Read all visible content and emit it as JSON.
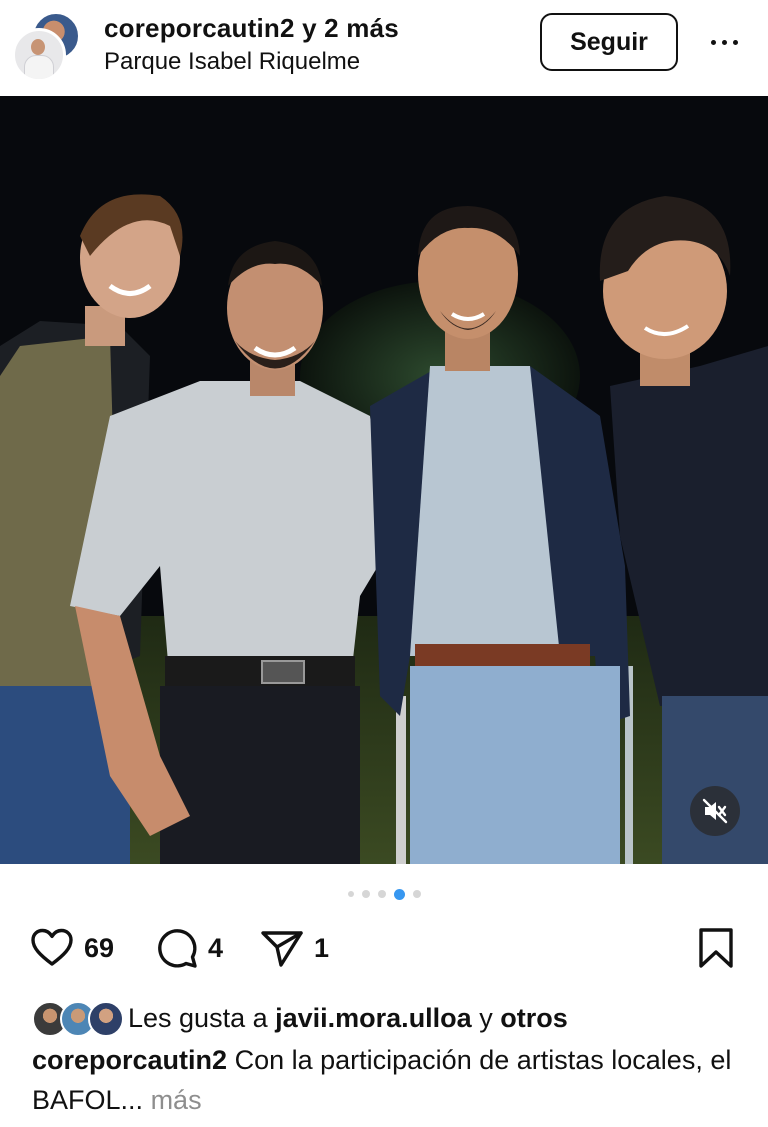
{
  "header": {
    "author": "coreporcautin2",
    "coauthors": "y 2 más",
    "location": "Parque Isabel Riquelme",
    "follow_label": "Seguir"
  },
  "carousel": {
    "total": 5,
    "active_index": 3
  },
  "actions": {
    "like_count": "69",
    "comment_count": "4",
    "share_count": "1"
  },
  "likes": {
    "prefix": "Les gusta a",
    "user": "javii.mora.ulloa",
    "connector": "y",
    "others": "otros"
  },
  "caption": {
    "author": "coreporcautin2",
    "text": "Con la participación de artistas locales, el BAFOL...",
    "more": "más"
  },
  "icons": {
    "avatar": "profile-avatar-icon",
    "more": "more-options-icon",
    "like": "heart-icon",
    "comment": "comment-icon",
    "share": "send-icon",
    "save": "bookmark-icon",
    "mute": "speaker-muted-icon"
  },
  "colors": {
    "accent": "#3797f0",
    "muted_text": "#8e8e8e",
    "photo_background": "#07090d"
  }
}
